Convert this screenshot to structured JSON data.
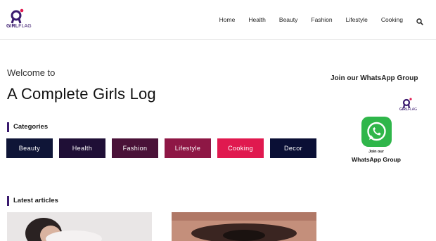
{
  "logo": {
    "brand_first": "GIRL",
    "brand_second": "FLAG"
  },
  "nav": {
    "items": [
      "Home",
      "Health",
      "Beauty",
      "Fashion",
      "Lifestyle",
      "Cooking"
    ]
  },
  "hero": {
    "welcome": "Welcome to",
    "title": "A Complete Girls Log"
  },
  "categories": {
    "heading": "Categories",
    "items": [
      {
        "label": "Beauty",
        "color": "#0f1537"
      },
      {
        "label": "Health",
        "color": "#1f0f36"
      },
      {
        "label": "Fashion",
        "color": "#4a1238"
      },
      {
        "label": "Lifestyle",
        "color": "#8e1745"
      },
      {
        "label": "Cooking",
        "color": "#e0194f"
      },
      {
        "label": "Decor",
        "color": "#0a0f35"
      }
    ]
  },
  "latest": {
    "heading": "Latest articles"
  },
  "sidebar": {
    "whatsapp_title": "Join our WhatsApp Group",
    "card_join": "Join our",
    "card_group": "WhatsApp Group",
    "card_brand_first": "GIRL",
    "card_brand_second": "FLAG"
  },
  "colors": {
    "accent": "#3a1a6e",
    "whatsapp": "#2fb64a"
  }
}
